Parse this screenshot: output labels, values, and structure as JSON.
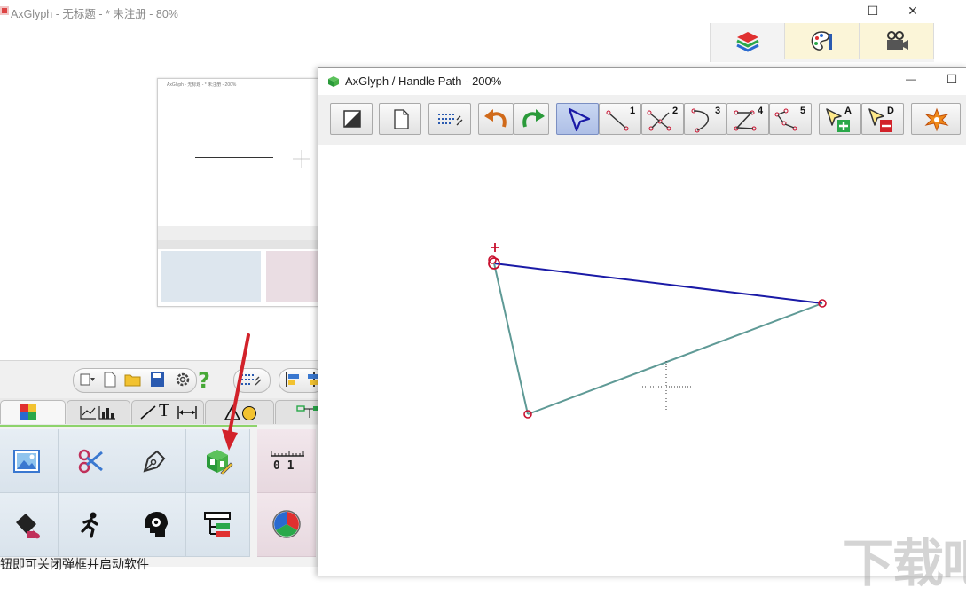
{
  "main_window": {
    "title": "AxGlyph - 无标题 - * 未注册 - 80%",
    "buttons": {
      "minimize": "—",
      "maximize": "☐",
      "close": "✕"
    }
  },
  "right_palette": {
    "icons": [
      "layers-icon",
      "palette-icon",
      "video-camera-icon"
    ]
  },
  "thumbnail": {
    "title": "AxGlyph - 无标题 - * 未注册 - 200%"
  },
  "panel": {
    "tabs": [
      {
        "label": "",
        "icon": "color-palette-icon"
      },
      {
        "label": "",
        "icon": "charts-icon"
      },
      {
        "label": "T",
        "icon": "line-text-dimension-icon"
      },
      {
        "label": "",
        "icon": "shapes-icon"
      },
      {
        "label": "",
        "icon": "flowchart-icon"
      }
    ],
    "tools_row1": [
      "image-icon",
      "scissors-icon",
      "pen-nib-icon",
      "glyph-edit-icon",
      "ruler-icon"
    ],
    "tools_row2": [
      "paint-bucket-icon",
      "runner-icon",
      "head-gear-icon",
      "tree-list-icon",
      "pie-chart-icon"
    ],
    "ruler_label": "0 1",
    "partial_caption": "钮即可关闭弹框并启动软件"
  },
  "handle_window": {
    "title": "AxGlyph / Handle Path - 200%",
    "buttons": {
      "minimize": "—",
      "maximize": "☐"
    },
    "toolbar": {
      "mode_numbers": [
        "1",
        "2",
        "3",
        "4",
        "5"
      ],
      "add_label": "A",
      "delete_label": "D"
    }
  },
  "colors": {
    "accent_blue": "#1a1aa6",
    "path_teal": "#5f9a96",
    "handle_red": "#c8102e",
    "panel_green": "#8dd36b",
    "annotation_red": "#d2222a"
  },
  "watermark": "下载吧"
}
